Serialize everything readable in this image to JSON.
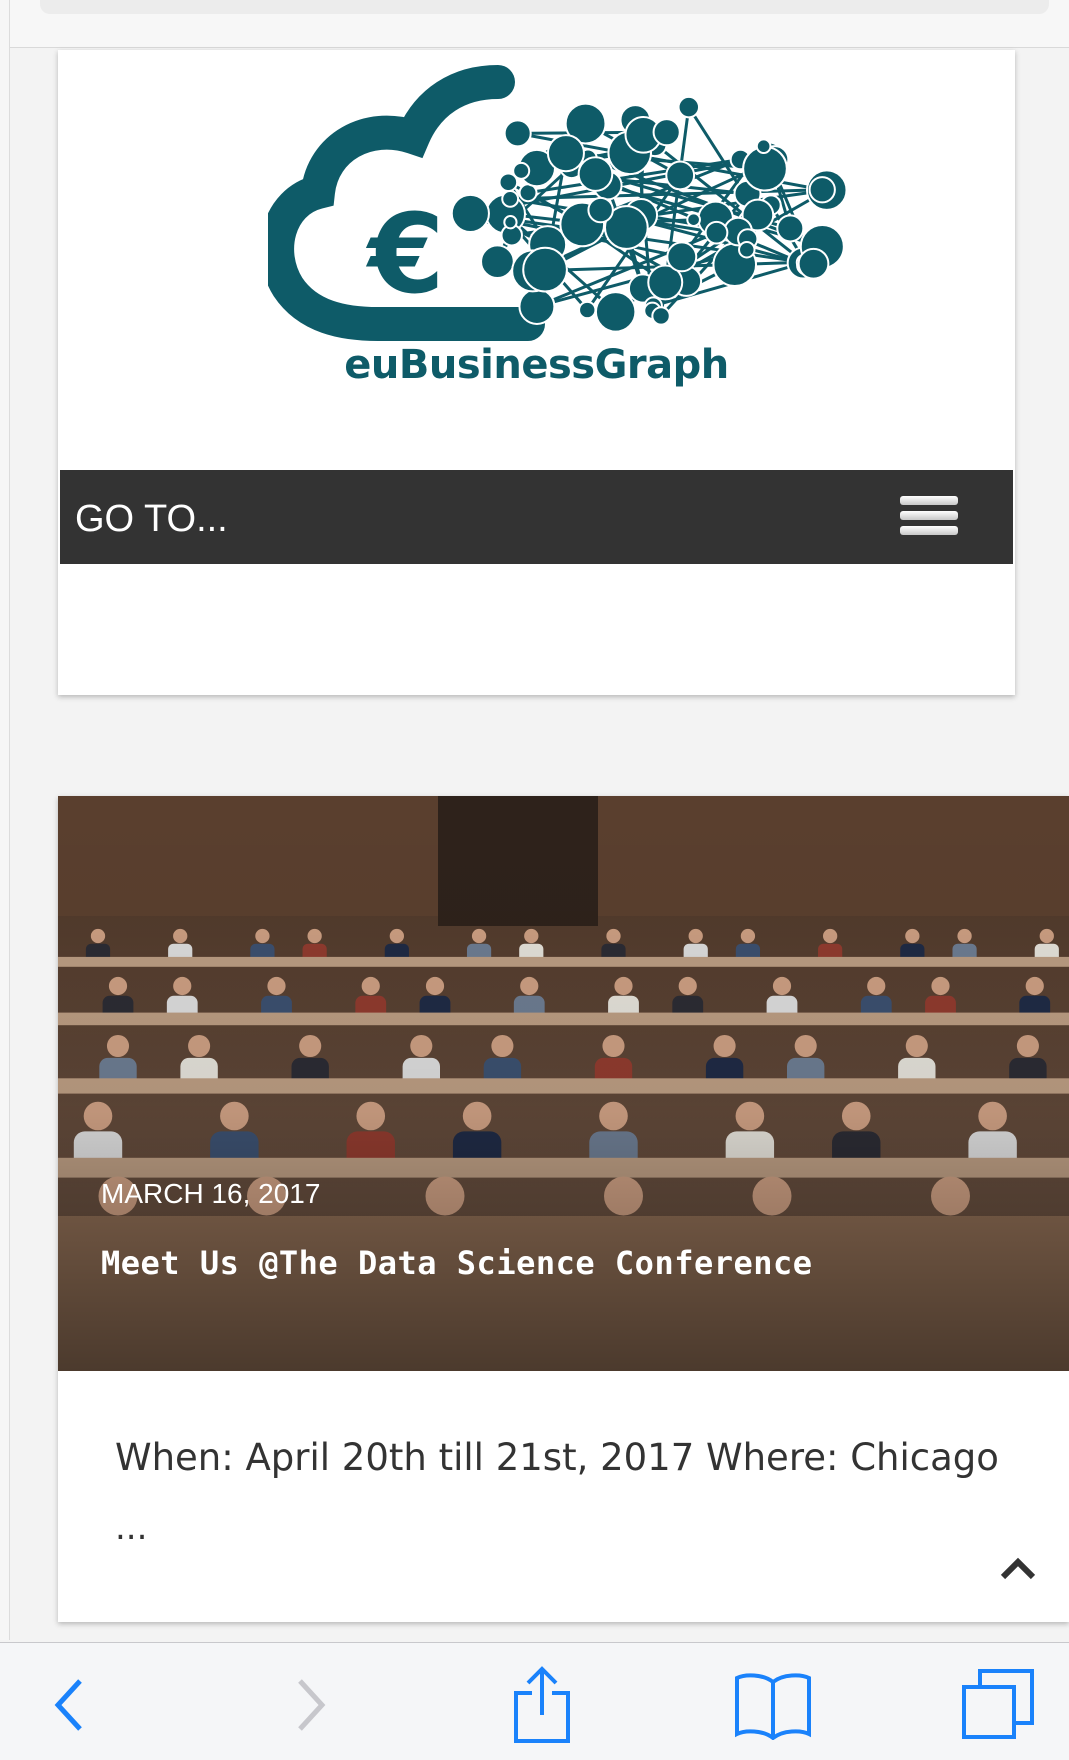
{
  "header": {
    "brand_name": "euBusinessGraph",
    "nav_label": "GO TO..."
  },
  "post": {
    "date": "MARCH 16, 2017",
    "title": "Meet Us @The Data Science Conference",
    "excerpt": "When: April 20th till 21st, 2017 Where: Chicago",
    "more": "..."
  },
  "colors": {
    "brand_teal": "#0e5b68",
    "nav_bg": "#333333",
    "toolbar_blue": "#1a82fb"
  },
  "icons": {
    "logo": "cloud-euro-network-logo",
    "menu": "hamburger-icon",
    "scroll_top": "chevron-up-icon",
    "back": "chevron-left-icon",
    "forward": "chevron-right-icon",
    "share": "share-icon",
    "bookmarks": "book-icon",
    "tabs": "tabs-icon"
  }
}
